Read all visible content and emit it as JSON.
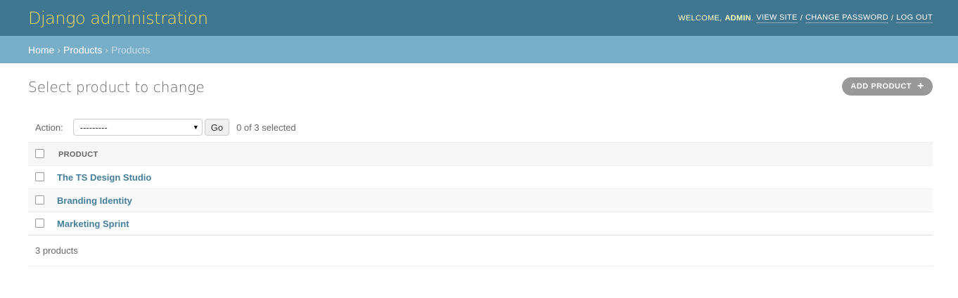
{
  "header": {
    "branding": "Django administration",
    "welcome": "Welcome,",
    "username": "admin",
    "view_site": "View site",
    "change_password": "Change password",
    "log_out": "Log out",
    "separator": "/"
  },
  "breadcrumbs": {
    "home": "Home",
    "app": "Products",
    "current": "Products",
    "arrow": "›"
  },
  "page": {
    "title": "Select product to change",
    "add_button": "Add product",
    "add_icon": "+"
  },
  "actions": {
    "label": "Action:",
    "selected_option": "---------",
    "go_label": "Go",
    "counter": "0 of 3 selected"
  },
  "table": {
    "header": "Product",
    "rows": [
      {
        "product": "The TS Design Studio"
      },
      {
        "product": "Branding Identity"
      },
      {
        "product": "Marketing Sprint"
      }
    ]
  },
  "paginator": {
    "count_text": "3 products"
  },
  "colors": {
    "header_bg": "#417690",
    "breadcrumbs_bg": "#79aec8",
    "branding": "#f5dd5d",
    "link": "#447e9b"
  },
  "icons": {
    "select_caret": "caret-down-icon",
    "add": "plus-icon"
  }
}
